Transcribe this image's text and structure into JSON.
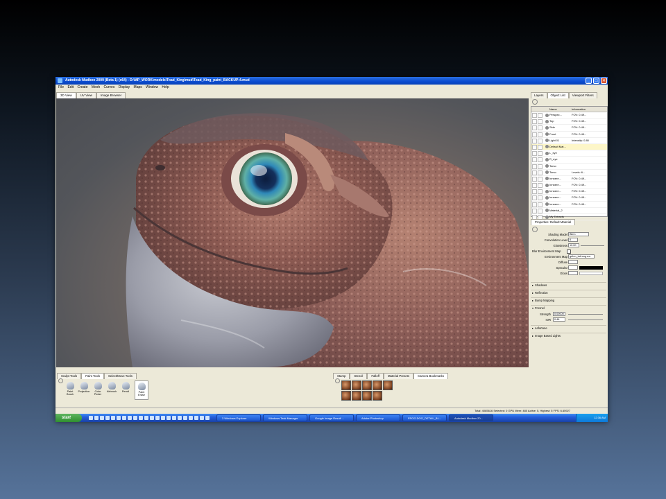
{
  "window": {
    "title": "Autodesk Mudbox 2009 (Beta 1) (x64) - D:\\MP_WORK\\models\\Toad_King\\mud\\Toad_King_paint_BACKUP-4.mud",
    "min": "_",
    "max": "□",
    "close": "✕"
  },
  "menu": [
    "File",
    "Edit",
    "Create",
    "Mesh",
    "Curves",
    "Display",
    "Maps",
    "Window",
    "Help"
  ],
  "view_tabs": [
    "3D View",
    "UV View",
    "Image Browser"
  ],
  "panel_tabs": [
    "Layers",
    "Object List",
    "Viewport Filters"
  ],
  "object_list": {
    "col_name": "Name",
    "col_info": "Information",
    "rows": [
      {
        "name": "Perspec...",
        "info": "FOV: 0.49..."
      },
      {
        "name": "Top",
        "info": "FOV: 0.49..."
      },
      {
        "name": "Side",
        "info": "FOV: 0.49..."
      },
      {
        "name": "Front",
        "info": "FOV: 0.49..."
      },
      {
        "name": "Light 01",
        "info": "Intensity: 0.80"
      },
      {
        "name": "Default Mat...",
        "info": ""
      },
      {
        "name": "L_eye",
        "info": ""
      },
      {
        "name": "R_eye",
        "info": ""
      },
      {
        "name": "Torso",
        "info": ""
      },
      {
        "name": "Torso",
        "info": "Levels: 6..."
      },
      {
        "name": "Innnere...",
        "info": "FOV: 0.49..."
      },
      {
        "name": "Innnere...",
        "info": "FOV: 0.49..."
      },
      {
        "name": "Innnere...",
        "info": "FOV: 0.49..."
      },
      {
        "name": "Innnere...",
        "info": "FOV: 0.49..."
      },
      {
        "name": "Innnere...",
        "info": "FOV: 0.49..."
      },
      {
        "name": "Material_2",
        "info": ""
      },
      {
        "name": "My Extracts",
        "info": ""
      }
    ]
  },
  "properties": {
    "tab": "Properties: Default Material",
    "shading_model_label": "Shading Model",
    "shading_model": "Blinn",
    "convolution_label": "Convolution Level",
    "convolution": "6",
    "glossiness_label": "Glossiness",
    "glossiness": "10.00",
    "blur_env_label": "Blur Environment Map",
    "env_map_label": "Environment Map",
    "env_map": "gdhm_latLong.exr",
    "diffuse_label": "Diffuse",
    "specular_label": "Specular",
    "gloss_label": "Gloss",
    "sections": [
      "Shadows",
      "Reflection",
      "Bump Mapping",
      "Fresnel",
      "Lafortune",
      "Image Based Lights"
    ],
    "strength_label": "Strength",
    "strength": "0.00000",
    "ior_label": "IOR",
    "ior": "0.46"
  },
  "tool_tabs": [
    "Sculpt Tools",
    "Paint Tools",
    "Select/Move Tools"
  ],
  "paint_tools": [
    "Paint Brush",
    "Projection",
    "Color Picker",
    "Airbrush",
    "Pencil",
    "Paint Erase"
  ],
  "stamp_tabs": [
    "Stamp",
    "Stencil",
    "Falloff",
    "Material Presets",
    "Camera Bookmarks"
  ],
  "status": "Total: 4085616  Selected: 0 GPU Mem: 480  Active: 5, Highest: 5  FPS: 6.65927",
  "taskbar": {
    "start": "start",
    "items": [
      "3 Windows Explorer",
      "Windows Task Manager",
      "Google Image Result ...",
      "Adobe Photoshop",
      "FROG.DOG_DETAIL_BL...",
      "Autodesk Mudbox 20..."
    ],
    "clock": "12:36 AM"
  }
}
